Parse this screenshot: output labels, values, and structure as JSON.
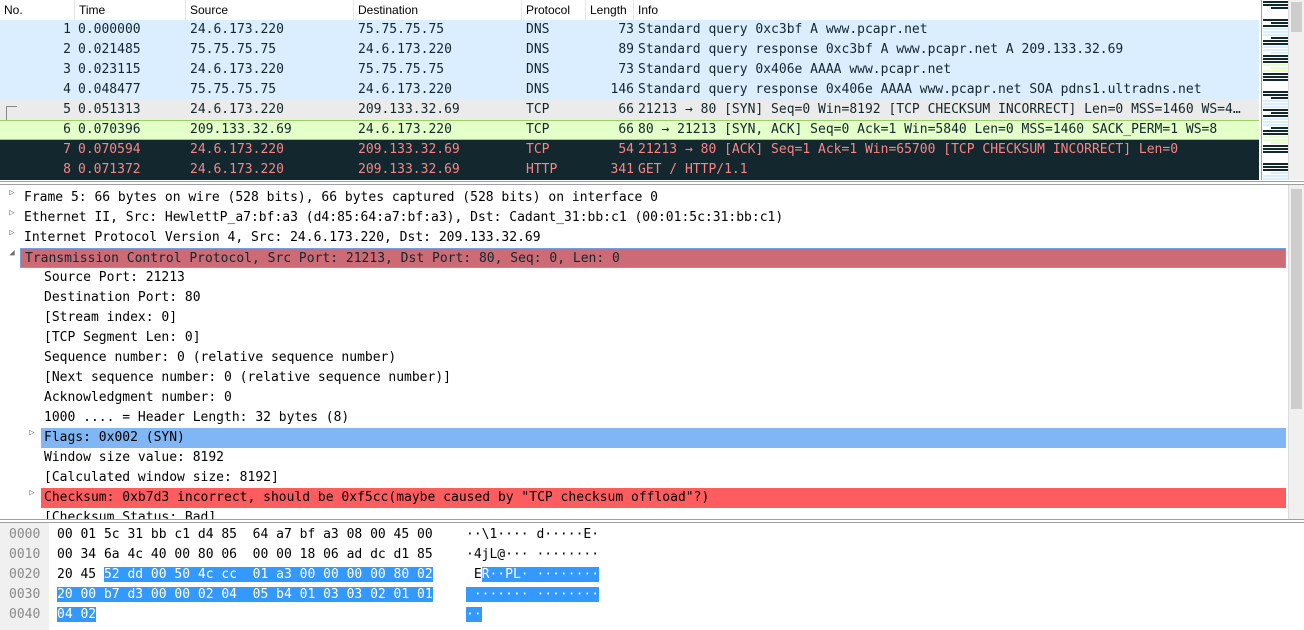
{
  "columns": {
    "no": "No.",
    "time": "Time",
    "source": "Source",
    "destination": "Destination",
    "protocol": "Protocol",
    "length": "Length",
    "info": "Info"
  },
  "packets": [
    {
      "no": "1",
      "time": "0.000000",
      "src": "24.6.173.220",
      "dst": "75.75.75.75",
      "proto": "DNS",
      "len": "73",
      "info": "Standard query 0xc3bf A www.pcapr.net"
    },
    {
      "no": "2",
      "time": "0.021485",
      "src": "75.75.75.75",
      "dst": "24.6.173.220",
      "proto": "DNS",
      "len": "89",
      "info": "Standard query response 0xc3bf A www.pcapr.net A 209.133.32.69"
    },
    {
      "no": "3",
      "time": "0.023115",
      "src": "24.6.173.220",
      "dst": "75.75.75.75",
      "proto": "DNS",
      "len": "73",
      "info": "Standard query 0x406e AAAA www.pcapr.net"
    },
    {
      "no": "4",
      "time": "0.048477",
      "src": "75.75.75.75",
      "dst": "24.6.173.220",
      "proto": "DNS",
      "len": "146",
      "info": "Standard query response 0x406e AAAA www.pcapr.net SOA pdns1.ultradns.net"
    },
    {
      "no": "5",
      "time": "0.051313",
      "src": "24.6.173.220",
      "dst": "209.133.32.69",
      "proto": "TCP",
      "len": "66",
      "info": "21213 → 80 [SYN] Seq=0 Win=8192 [TCP CHECKSUM INCORRECT] Len=0 MSS=1460 WS=4…"
    },
    {
      "no": "6",
      "time": "0.070396",
      "src": "209.133.32.69",
      "dst": "24.6.173.220",
      "proto": "TCP",
      "len": "66",
      "info": "80 → 21213 [SYN, ACK] Seq=0 Ack=1 Win=5840 Len=0 MSS=1460 SACK_PERM=1 WS=8"
    },
    {
      "no": "7",
      "time": "0.070594",
      "src": "24.6.173.220",
      "dst": "209.133.32.69",
      "proto": "TCP",
      "len": "54",
      "info": "21213 → 80 [ACK] Seq=1 Ack=1 Win=65700 [TCP CHECKSUM INCORRECT] Len=0"
    },
    {
      "no": "8",
      "time": "0.071372",
      "src": "24.6.173.220",
      "dst": "209.133.32.69",
      "proto": "HTTP",
      "len": "341",
      "info": "GET / HTTP/1.1"
    }
  ],
  "details": [
    "Frame 5: 66 bytes on wire (528 bits), 66 bytes captured (528 bits) on interface 0",
    "Ethernet II, Src: HewlettP_a7:bf:a3 (d4:85:64:a7:bf:a3), Dst: Cadant_31:bb:c1 (00:01:5c:31:bb:c1)",
    "Internet Protocol Version 4, Src: 24.6.173.220, Dst: 209.133.32.69",
    "Transmission Control Protocol, Src Port: 21213, Dst Port: 80, Seq: 0, Len: 0",
    "Source Port: 21213",
    "Destination Port: 80",
    "[Stream index: 0]",
    "[TCP Segment Len: 0]",
    "Sequence number: 0    (relative sequence number)",
    "[Next sequence number: 0    (relative sequence number)]",
    "Acknowledgment number: 0",
    "1000 .... = Header Length: 32 bytes (8)",
    "Flags: 0x002 (SYN)",
    "Window size value: 8192",
    "[Calculated window size: 8192]",
    "Checksum: 0xb7d3 incorrect, should be 0xf5cc(maybe caused by \"TCP checksum offload\"?)",
    "[Checksum Status: Bad]"
  ],
  "bytes": [
    {
      "offset": "0000",
      "hex_plain": "00 01 5c 31 bb c1 d4 85  64 a7 bf a3 08 00 45 00",
      "hex_sel": "",
      "ascii_plain": "··\\1···· d·····E·",
      "ascii_sel": ""
    },
    {
      "offset": "0010",
      "hex_plain": "00 34 6a 4c 40 00 80 06  00 00 18 06 ad dc d1 85",
      "hex_sel": "",
      "ascii_plain": "·4jL@··· ········",
      "ascii_sel": ""
    },
    {
      "offset": "0020",
      "hex_plain": "20 45 ",
      "hex_sel": "52 dd 00 50 4c cc  01 a3 00 00 00 00 80 02",
      "ascii_plain": " E",
      "ascii_sel": "R··PL· ········"
    },
    {
      "offset": "0030",
      "hex_plain": "",
      "hex_sel": "20 00 b7 d3 00 00 02 04  05 b4 01 03 03 02 01 01",
      "ascii_plain": "",
      "ascii_sel": " ······· ········"
    },
    {
      "offset": "0040",
      "hex_plain": "",
      "hex_sel": "04 02",
      "ascii_plain": "",
      "ascii_sel": "··"
    }
  ]
}
